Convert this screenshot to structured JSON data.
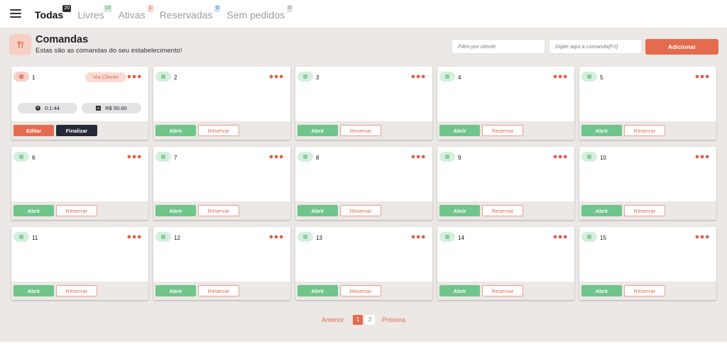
{
  "tabs": [
    {
      "label": "Todas",
      "count": "20",
      "active": true
    },
    {
      "label": "Livres",
      "count": "19",
      "active": false
    },
    {
      "label": "Ativas",
      "count": "1",
      "active": false
    },
    {
      "label": "Reservadas",
      "count": "0",
      "active": false
    },
    {
      "label": "Sem pedidos",
      "count": "0",
      "active": false
    }
  ],
  "header": {
    "title": "Comandas",
    "subtitle": "Estas são as comandas do seu estabelecimento!",
    "icon": "utensils-icon",
    "filter_client_placeholder": "Filtre por cliente",
    "order_input_placeholder": "Digite aqui a comanda(F2)",
    "add_button": "Adicionar"
  },
  "card_labels": {
    "open": "Abrir",
    "reserve": "Reservar",
    "edit": "Editar",
    "finish": "Finalizar",
    "menu_icon": "more-dots-icon"
  },
  "cards": [
    {
      "number": "1",
      "status": "active",
      "origin": "Via Cliente",
      "time": "0:1:44",
      "total": "R$ 50.60"
    },
    {
      "number": "2",
      "status": "free"
    },
    {
      "number": "3",
      "status": "free"
    },
    {
      "number": "4",
      "status": "free"
    },
    {
      "number": "5",
      "status": "free"
    },
    {
      "number": "6",
      "status": "free"
    },
    {
      "number": "7",
      "status": "free"
    },
    {
      "number": "8",
      "status": "free"
    },
    {
      "number": "9",
      "status": "free"
    },
    {
      "number": "10",
      "status": "free"
    },
    {
      "number": "11",
      "status": "free"
    },
    {
      "number": "12",
      "status": "free"
    },
    {
      "number": "13",
      "status": "free"
    },
    {
      "number": "14",
      "status": "free"
    },
    {
      "number": "15",
      "status": "free"
    }
  ],
  "pagination": {
    "previous": "Anterior",
    "next": "Próxima",
    "pages": [
      "1",
      "2"
    ],
    "current": "1"
  },
  "colors": {
    "accent": "#e46b4d",
    "free_green": "#6fc58a",
    "active_pill": "#f6d0c5",
    "free_pill": "#d4f0dc",
    "badge_todas": "#2d2d2d",
    "badge_livres": "#d4f0dc",
    "badge_ativas": "#f9d3c6",
    "badge_reservadas": "#cfe0f8",
    "badge_sem_pedidos": "#e3e3e6"
  }
}
